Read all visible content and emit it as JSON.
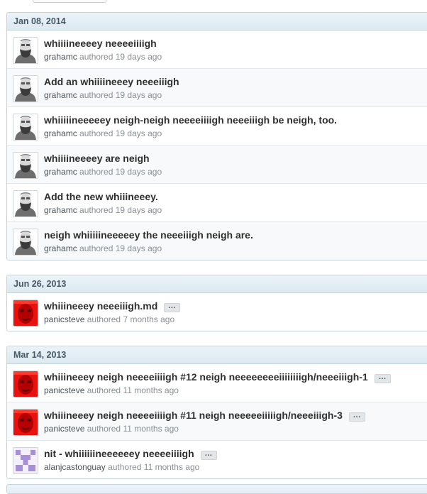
{
  "groups": [
    {
      "date": "Jan 08, 2014",
      "commits": [
        {
          "message": "whiiiineeeey neeeeiiiigh",
          "author": "grahamc",
          "verb": "authored",
          "when": "19 days ago",
          "avatar": "grahamc-avatar",
          "ellipsis": false
        },
        {
          "message": "Add an whiiiineeey neeeiiigh",
          "author": "grahamc",
          "verb": "authored",
          "when": "19 days ago",
          "avatar": "grahamc-avatar",
          "ellipsis": false
        },
        {
          "message": "whiiiiineeeeey neigh-neigh neeeeiiiigh neeeiiigh be neigh, too.",
          "author": "grahamc",
          "verb": "authored",
          "when": "19 days ago",
          "avatar": "grahamc-avatar",
          "ellipsis": false
        },
        {
          "message": "whiiiineeeey are neigh",
          "author": "grahamc",
          "verb": "authored",
          "when": "19 days ago",
          "avatar": "grahamc-avatar",
          "ellipsis": false
        },
        {
          "message": "Add the new whiiineeey.",
          "author": "grahamc",
          "verb": "authored",
          "when": "19 days ago",
          "avatar": "grahamc-avatar",
          "ellipsis": false
        },
        {
          "message": "neigh whiiiiineeeeey the neeeiiigh neigh are.",
          "author": "grahamc",
          "verb": "authored",
          "when": "19 days ago",
          "avatar": "grahamc-avatar",
          "ellipsis": false
        }
      ]
    },
    {
      "date": "Jun 26, 2013",
      "commits": [
        {
          "message": "whiiineeey neeeiiigh.md",
          "author": "panicsteve",
          "verb": "authored",
          "when": "7 months ago",
          "avatar": "panicsteve-avatar",
          "ellipsis": true
        }
      ]
    },
    {
      "date": "Mar 14, 2013",
      "commits": [
        {
          "message": "whiiineeey neigh neeeeiiiigh #12 neigh neeeeeeeeiiiiiiiigh/neeeiiigh-1",
          "author": "panicsteve",
          "verb": "authored",
          "when": "11 months ago",
          "avatar": "panicsteve-avatar",
          "ellipsis": true
        },
        {
          "message": "whiiineeey neigh neeeeiiiigh #11 neigh neeeeeiiiiigh/neeeiiigh-3",
          "author": "panicsteve",
          "verb": "authored",
          "when": "11 months ago",
          "avatar": "panicsteve-avatar",
          "ellipsis": true
        },
        {
          "message": "nit - whiiiiiineeeeeey neeeeiiiigh",
          "author": "alanjcastonguay",
          "verb": "authored",
          "when": "11 months ago",
          "avatar": "identicon-avatar",
          "ellipsis": true
        }
      ]
    }
  ],
  "ellipsis_label": "…",
  "colors": {
    "header_bg": "#e2edf3",
    "header_text": "#475966",
    "border": "#c5d5dd",
    "panic_red": "#e8130f",
    "identicon_purple": "#a78ed9"
  }
}
